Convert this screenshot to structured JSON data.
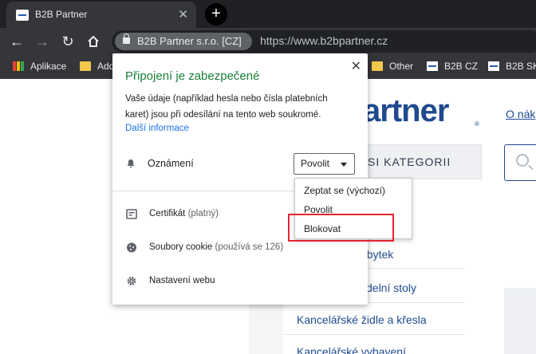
{
  "browser": {
    "tab": {
      "title": "B2B Partner"
    },
    "toolbar": {
      "site_chip": "B2B Partner s.r.o. [CZ]",
      "url": "https://www.b2bpartner.cz"
    },
    "bookmarks": [
      {
        "label": "Aplikace",
        "icon": "apps-icon"
      },
      {
        "label": "Add",
        "icon": "folder-icon"
      },
      {
        "label": "Other",
        "icon": "folder-icon"
      },
      {
        "label": "B2B CZ",
        "icon": "b2b-logo-icon"
      },
      {
        "label": "B2B SK",
        "icon": "b2b-logo-icon"
      }
    ]
  },
  "page": {
    "logo": "artner",
    "top_link": "O nák",
    "category_button": "SI KATEGORII",
    "categories": [
      "ábytek",
      "jídelní stoly",
      "Kancelářské židle a křesla",
      "Kancelářské vybavení"
    ]
  },
  "popup": {
    "title": "Připojení je zabezpečené",
    "description": "Vaše údaje (například hesla nebo čísla platebních karet) jsou při odesílání na tento web soukromé.",
    "more_link": "Další informace",
    "notifications_label": "Oznámení",
    "notifications_value": "Povolit",
    "certificate_label": "Certifikát",
    "certificate_status": "(platný)",
    "cookies_label": "Soubory cookie",
    "cookies_status": "(používá se 126)",
    "site_settings_label": "Nastavení webu"
  },
  "dropdown": {
    "options": [
      "Zeptat se (výchozí)",
      "Povolit",
      "Blokovat"
    ],
    "highlighted": "Blokovat"
  },
  "colors": {
    "secure_green": "#188038",
    "link_blue": "#1a73e8",
    "brand_blue": "#1f4a8f",
    "highlight_red": "#e3262f"
  }
}
